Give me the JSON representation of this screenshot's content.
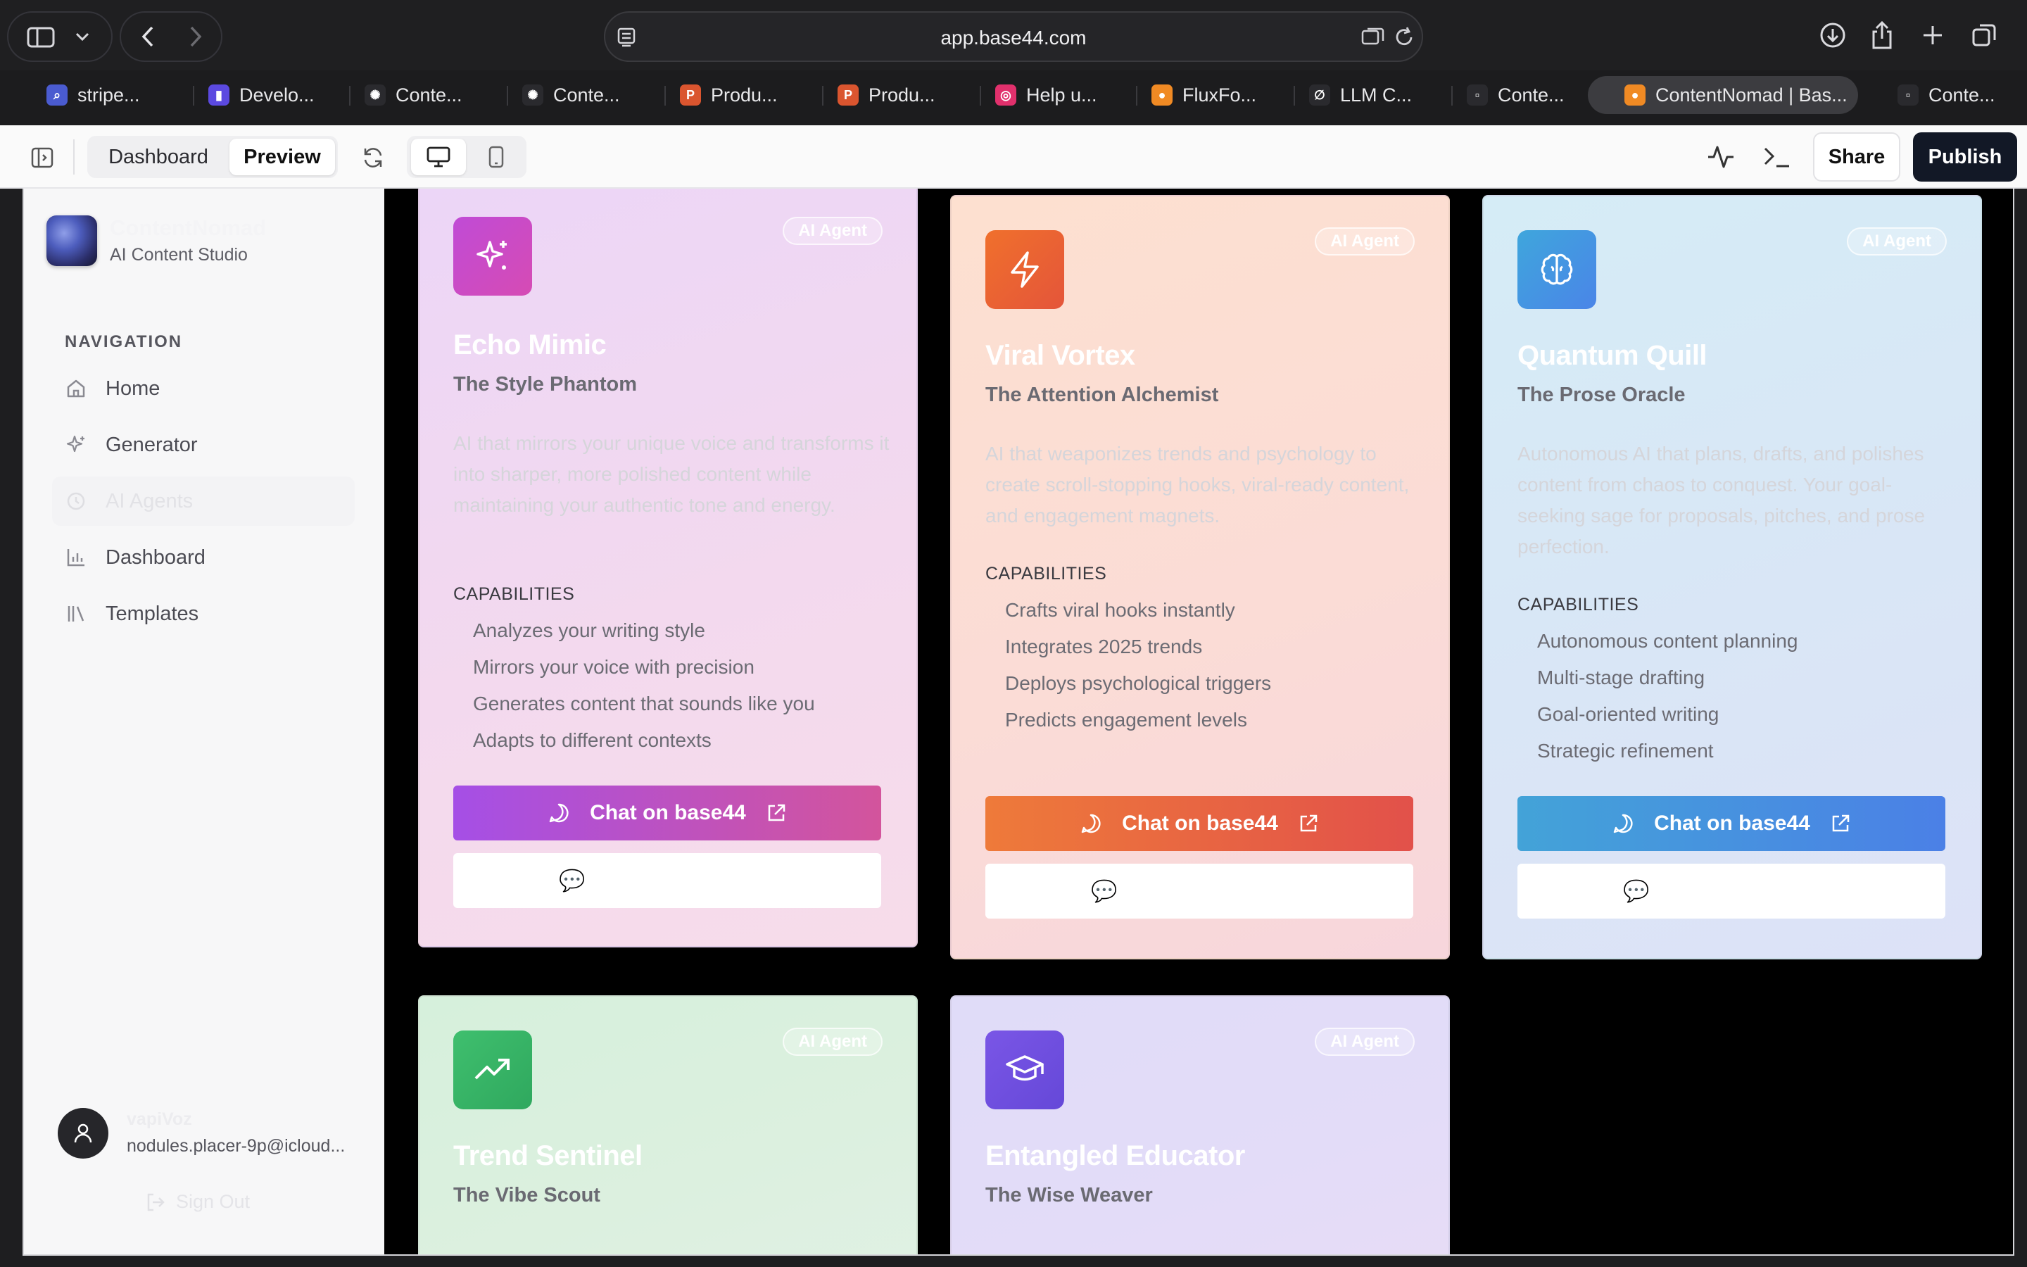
{
  "browser": {
    "url": "app.base44.com",
    "tabs": [
      {
        "label": "stripe...",
        "icon": "search-icon",
        "color": "#4a5bd0"
      },
      {
        "label": "Develo...",
        "icon": "dev-icon",
        "color": "#5b49e0"
      },
      {
        "label": "Conte...",
        "icon": "openai-icon",
        "color": "#2a2a2e"
      },
      {
        "label": "Conte...",
        "icon": "openai-icon",
        "color": "#2a2a2e"
      },
      {
        "label": "Produ...",
        "icon": "producthunt-icon",
        "color": "#da552f"
      },
      {
        "label": "Produ...",
        "icon": "producthunt-icon",
        "color": "#da552f"
      },
      {
        "label": "Help u...",
        "icon": "instagram-icon",
        "color": "#e1306c"
      },
      {
        "label": "FluxFo...",
        "icon": "base44-icon",
        "color": "#f08a24"
      },
      {
        "label": "LLM C...",
        "icon": "llm-icon",
        "color": "#2a2a2e"
      },
      {
        "label": "Conte...",
        "icon": "page-icon",
        "color": "#2a2a2e"
      },
      {
        "label": "ContentNomad | Bas...",
        "icon": "base44-icon",
        "color": "#f08a24",
        "active": true
      },
      {
        "label": "Conte...",
        "icon": "page-icon",
        "color": "#2a2a2e"
      }
    ]
  },
  "toolbar": {
    "dashboard_label": "Dashboard",
    "preview_label": "Preview",
    "share_label": "Share",
    "publish_label": "Publish"
  },
  "sidebar": {
    "brand_name": "ContentNomad",
    "brand_sub": "AI Content Studio",
    "nav_heading": "NAVIGATION",
    "items": [
      {
        "label": "Home",
        "icon": "home-icon"
      },
      {
        "label": "Generator",
        "icon": "sparkle-icon"
      },
      {
        "label": "AI Agents",
        "icon": "agent-icon",
        "active": true
      },
      {
        "label": "Dashboard",
        "icon": "bar-chart-icon"
      },
      {
        "label": "Templates",
        "icon": "library-icon"
      }
    ],
    "user_name": "vapiVoz",
    "user_email": "nodules.placer-9p@icloud...",
    "sign_out": "Sign Out"
  },
  "cards": [
    {
      "badge": "AI Agent",
      "icon": "sparkles-icon",
      "title": "Echo Mimic",
      "subtitle": "The Style Phantom",
      "description": "AI that mirrors your unique voice and transforms it into sharper, more polished content while maintaining your authentic tone and energy.",
      "capabilities_label": "CAPABILITIES",
      "capabilities": [
        "Analyzes your writing style",
        "Mirrors your voice with precision",
        "Generates content that sounds like you",
        "Adapts to different contexts"
      ],
      "chat_label": "Chat on base44",
      "secondary_glyph": "💬"
    },
    {
      "badge": "AI Agent",
      "icon": "lightning-icon",
      "title": "Viral Vortex",
      "subtitle": "The Attention Alchemist",
      "description": "AI that weaponizes trends and psychology to create scroll-stopping hooks, viral-ready content, and engagement magnets.",
      "capabilities_label": "CAPABILITIES",
      "capabilities": [
        "Crafts viral hooks instantly",
        "Integrates 2025 trends",
        "Deploys psychological triggers",
        "Predicts engagement levels"
      ],
      "chat_label": "Chat on base44",
      "secondary_glyph": "💬"
    },
    {
      "badge": "AI Agent",
      "icon": "brain-icon",
      "title": "Quantum Quill",
      "subtitle": "The Prose Oracle",
      "description": "Autonomous AI that plans, drafts, and polishes content from chaos to conquest. Your goal-seeking sage for proposals, pitches, and prose perfection.",
      "capabilities_label": "CAPABILITIES",
      "capabilities": [
        "Autonomous content planning",
        "Multi-stage drafting",
        "Goal-oriented writing",
        "Strategic refinement"
      ],
      "chat_label": "Chat on base44",
      "secondary_glyph": "💬"
    },
    {
      "badge": "AI Agent",
      "icon": "trending-up-icon",
      "title": "Trend Sentinel",
      "subtitle": "The Vibe Scout"
    },
    {
      "badge": "AI Agent",
      "icon": "graduation-cap-icon",
      "title": "Entangled Educator",
      "subtitle": "The Wise Weaver"
    }
  ]
}
